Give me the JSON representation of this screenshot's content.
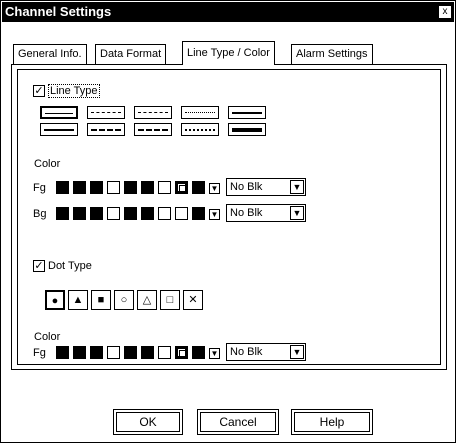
{
  "window": {
    "title": "Channel Settings",
    "close_glyph": "x"
  },
  "tabs": [
    {
      "label": "General Info."
    },
    {
      "label": "Data Format"
    },
    {
      "label": "Line Type / Color"
    },
    {
      "label": "Alarm Settings"
    }
  ],
  "line_section": {
    "checkbox_label": "Line Type",
    "checked_mark": "✓"
  },
  "line_color": {
    "label": "Color",
    "fg_label": "Fg",
    "bg_label": "Bg"
  },
  "dot_section": {
    "checkbox_label": "Dot Type",
    "checked_mark": "✓",
    "dots": [
      "●",
      "▲",
      "■",
      "○",
      "△",
      "□",
      "✕"
    ]
  },
  "dot_color": {
    "label": "Color",
    "fg_label": "Fg"
  },
  "dropdowns": {
    "line_fg": "No Blk",
    "line_bg": "No Blk",
    "dot_fg": "No Blk",
    "arrow": "▼"
  },
  "buttons": {
    "ok": "OK",
    "cancel": "Cancel",
    "help": "Help"
  }
}
